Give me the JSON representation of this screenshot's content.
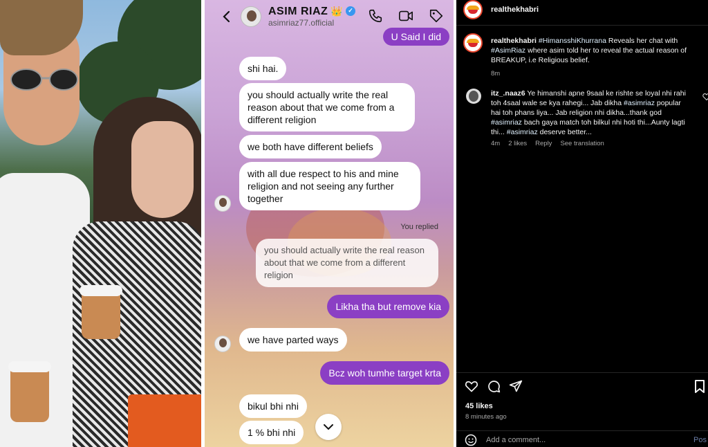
{
  "chat": {
    "header": {
      "name": "ASIM RIAZ",
      "crown": "👑",
      "handle": "asimriaz77.official"
    },
    "messages": {
      "partial_top": "U Said I did",
      "m1": "shi hai.",
      "m2": "you should actually write the real reason about that we come from a different religion",
      "m3": "we both have different beliefs",
      "m4": "with all due respect to his and mine religion and not seeing any further together",
      "you_replied": "You replied",
      "quote": "you should actually write the real reason about that we come from a different religion",
      "out1": "Likha tha but remove kia",
      "m5": "we have parted ways",
      "out2": "Bcz woh tumhe target krta",
      "m6": "bikul bhi nhi",
      "m7": "1 % bhi nhi"
    }
  },
  "instagram": {
    "top_username": "realthekhabri",
    "caption": {
      "username": "realthekhabri",
      "tag1": "#HimansshiKhurrana",
      "text1": " Reveals her chat with ",
      "tag2": "#AsimRiaz",
      "text2": " where asim told her to reveal the actual reason of BREAKUP, i.e Religious belief.",
      "time": "8m"
    },
    "comment": {
      "username": "itz_.naaz6",
      "text1": " Ye himanshi apne 9saal ke rishte se loyal nhi rahi toh 4saal wale se kya rahegi... Jab dikha ",
      "tag1": "#asimriaz",
      "text2": " popular hai toh phans liya... Jab religion nhi dikha...thank god ",
      "tag2": "#asimriaz",
      "text3": " bach gaya match toh bilkul nhi hoti thi...Aunty lagti thi... ",
      "tag3": "#asimriaz",
      "text4": " deserve better...",
      "time": "4m",
      "likes": "2 likes",
      "reply": "Reply",
      "translation": "See translation"
    },
    "likes": "45 likes",
    "posted_ago": "8 minutes ago",
    "add_comment_placeholder": "Add a comment...",
    "post_label": "Pos"
  },
  "colors": {
    "outgoing_bubble": "#8b3fc4",
    "ig_background": "#000000",
    "verified_blue": "#3897f0"
  }
}
